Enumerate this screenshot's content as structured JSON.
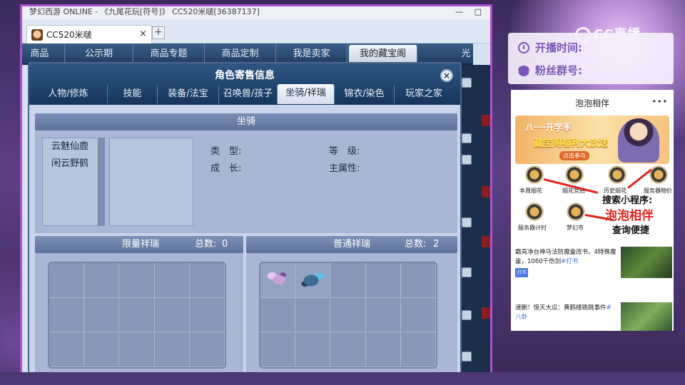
{
  "browser": {
    "title": "梦幻西游 ONLINE - 《九尾花玩[符号]》 CC520米啵[36387137]",
    "tab_label": "CC520米啵",
    "tab_close": "×",
    "new_tab": "+",
    "window_controls": "— □"
  },
  "game_nav": {
    "items": [
      {
        "label": "商品"
      },
      {
        "label": "公示期"
      },
      {
        "label": "商品专题"
      },
      {
        "label": "商品定制"
      },
      {
        "label": "我是卖家"
      },
      {
        "label": "我的藏宝阁"
      }
    ],
    "active_index": 5,
    "strip_glyph": "光"
  },
  "dialog": {
    "title": "角色寄售信息",
    "close": "×",
    "tabs": [
      {
        "label": "人物/修炼"
      },
      {
        "label": "技能"
      },
      {
        "label": "装备/法宝"
      },
      {
        "label": "召唤兽/孩子"
      },
      {
        "label": "坐骑/祥瑞"
      },
      {
        "label": "锦衣/染色"
      },
      {
        "label": "玩家之家"
      }
    ],
    "active_tab": 4,
    "mount_section": {
      "header": "坐骑",
      "list": [
        "云魅仙鹿",
        "闲云野鹤"
      ],
      "attrs": {
        "type_label": "类　型:",
        "growth_label": "成　长:",
        "level_label": "等　级:",
        "main_attr_label": "主属性:"
      }
    },
    "limited": {
      "header": "限量祥瑞",
      "total_label": "总数:",
      "total": "0"
    },
    "normal": {
      "header": "普通祥瑞",
      "total_label": "总数:",
      "total": "2"
    }
  },
  "stream": {
    "logo": "CC直播",
    "start_time_label": "开播时间:",
    "fan_group_label": "粉丝群号:"
  },
  "phone": {
    "title": "泡泡相伴",
    "menu": "•••",
    "banner_line1": "八一·开学季",
    "banner_line2": "藏宝阁福利大放送",
    "banner_button": "点击参与",
    "icons": [
      {
        "label": "本周烟花"
      },
      {
        "label": "烟花竞拍"
      },
      {
        "label": "历史烟花"
      },
      {
        "label": "服务器物价"
      },
      {
        "label": "服务器计时"
      },
      {
        "label": "梦幻市"
      }
    ],
    "promo_line1": "搜索小程序:",
    "promo_line2": "泡泡相伴",
    "promo_line3": "查询便捷",
    "news": [
      {
        "text": "霸亮净台神马法防魔童改书，4特殊魔童，1060千伤剑",
        "tag": "#打书",
        "badge": "打书"
      },
      {
        "text": "速删！惊天大瓜：黄鹤楼跳跳事件",
        "tag": "#八卦",
        "badge": ""
      }
    ]
  }
}
